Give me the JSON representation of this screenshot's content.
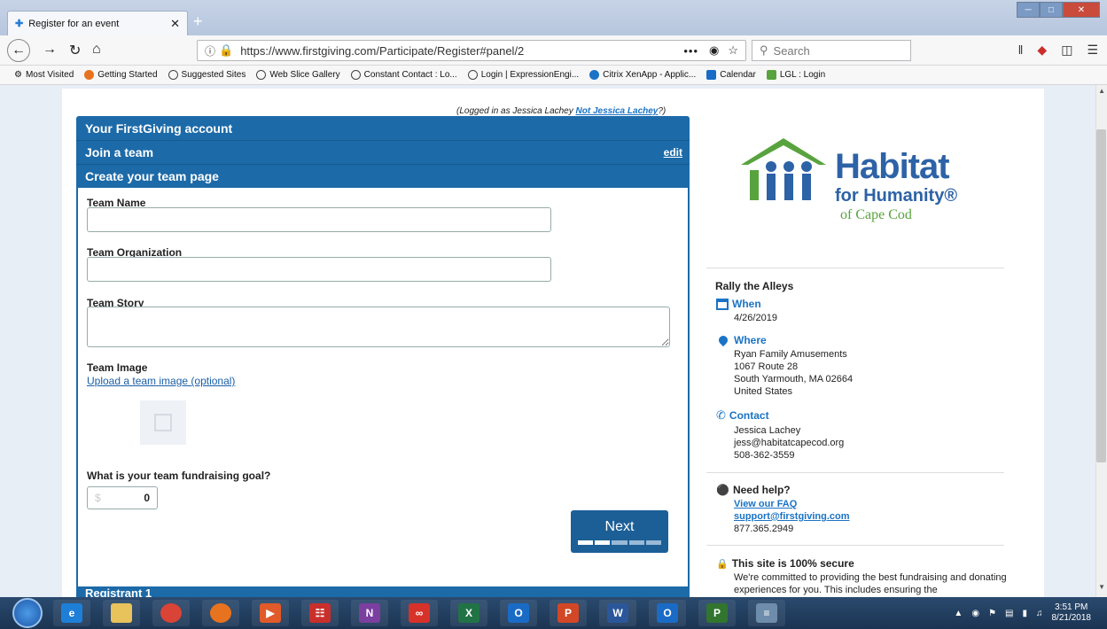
{
  "browser": {
    "tab_title": "Register for an event",
    "url": "https://www.firstgiving.com/Participate/Register#panel/2",
    "search_placeholder": "Search",
    "url_dots": "•••"
  },
  "bookmarks": [
    "Most Visited",
    "Getting Started",
    "Suggested Sites",
    "Web Slice Gallery",
    "Constant Contact : Lo...",
    "Login | ExpressionEngi...",
    "Citrix XenApp - Applic...",
    "Calendar",
    "LGL : Login"
  ],
  "login": {
    "prefix": "(Logged in as Jessica Lachey ",
    "link": "Not Jessica Lachey",
    "suffix": "?)"
  },
  "panels": {
    "account": "Your FirstGiving account",
    "join": "Join a team",
    "edit": "edit",
    "create": "Create your team page",
    "registrant": "Registrant 1"
  },
  "form": {
    "team_name_label": "Team Name",
    "team_org_label": "Team Organization",
    "team_story_label": "Team Story",
    "team_image_label": "Team Image",
    "upload_link": "Upload a team image (optional)",
    "goal_label": "What is your team fundraising goal?",
    "goal_currency": "$",
    "goal_value": "0",
    "next_label": "Next",
    "progress_step": 2,
    "progress_total": 5
  },
  "logo": {
    "line1": "Habitat",
    "line2": "for Humanity®",
    "line3": "of Cape Cod",
    "green": "#58a33e",
    "blue": "#2d62a6"
  },
  "event": {
    "name": "Rally the Alleys",
    "when_label": "When",
    "when_value": "4/26/2019",
    "where_label": "Where",
    "where_lines": [
      "Ryan Family Amusements",
      "1067 Route 28",
      "South Yarmouth, MA 02664",
      "United States"
    ],
    "contact_label": "Contact",
    "contact_lines": [
      "Jessica Lachey",
      "jess@habitatcapecod.org",
      "508-362-3559"
    ]
  },
  "help": {
    "title": "Need help?",
    "faq": "View our FAQ",
    "email": "support@firstgiving.com",
    "phone": "877.365.2949"
  },
  "secure": {
    "title": "This site is 100% secure",
    "text": "We're committed to providing the best fundraising and donating experiences for you. This includes ensuring the"
  },
  "taskbar": {
    "time": "3:51 PM",
    "date": "8/21/2018",
    "apps": [
      {
        "name": "internet-explorer",
        "glyph": "e",
        "color": "#1e7fd8"
      },
      {
        "name": "file-explorer",
        "glyph": "",
        "color": "#e8c25a"
      },
      {
        "name": "chrome",
        "glyph": "",
        "color": "#d94436"
      },
      {
        "name": "firefox",
        "glyph": "",
        "color": "#e8731f"
      },
      {
        "name": "media-player",
        "glyph": "▶",
        "color": "#e05a2a"
      },
      {
        "name": "acrobat",
        "glyph": "☷",
        "color": "#c9302c"
      },
      {
        "name": "onenote",
        "glyph": "N",
        "color": "#7b3fa0"
      },
      {
        "name": "creative-cloud",
        "glyph": "∞",
        "color": "#d6322a"
      },
      {
        "name": "excel",
        "glyph": "X",
        "color": "#217346"
      },
      {
        "name": "outlook",
        "glyph": "O",
        "color": "#1a6bc6"
      },
      {
        "name": "powerpoint",
        "glyph": "P",
        "color": "#d24726"
      },
      {
        "name": "word",
        "glyph": "W",
        "color": "#2b579a"
      },
      {
        "name": "outlook-2",
        "glyph": "O",
        "color": "#1a6bc6"
      },
      {
        "name": "project",
        "glyph": "P",
        "color": "#31752f"
      },
      {
        "name": "calculator",
        "glyph": "≡",
        "color": "#6e8cab"
      }
    ]
  }
}
